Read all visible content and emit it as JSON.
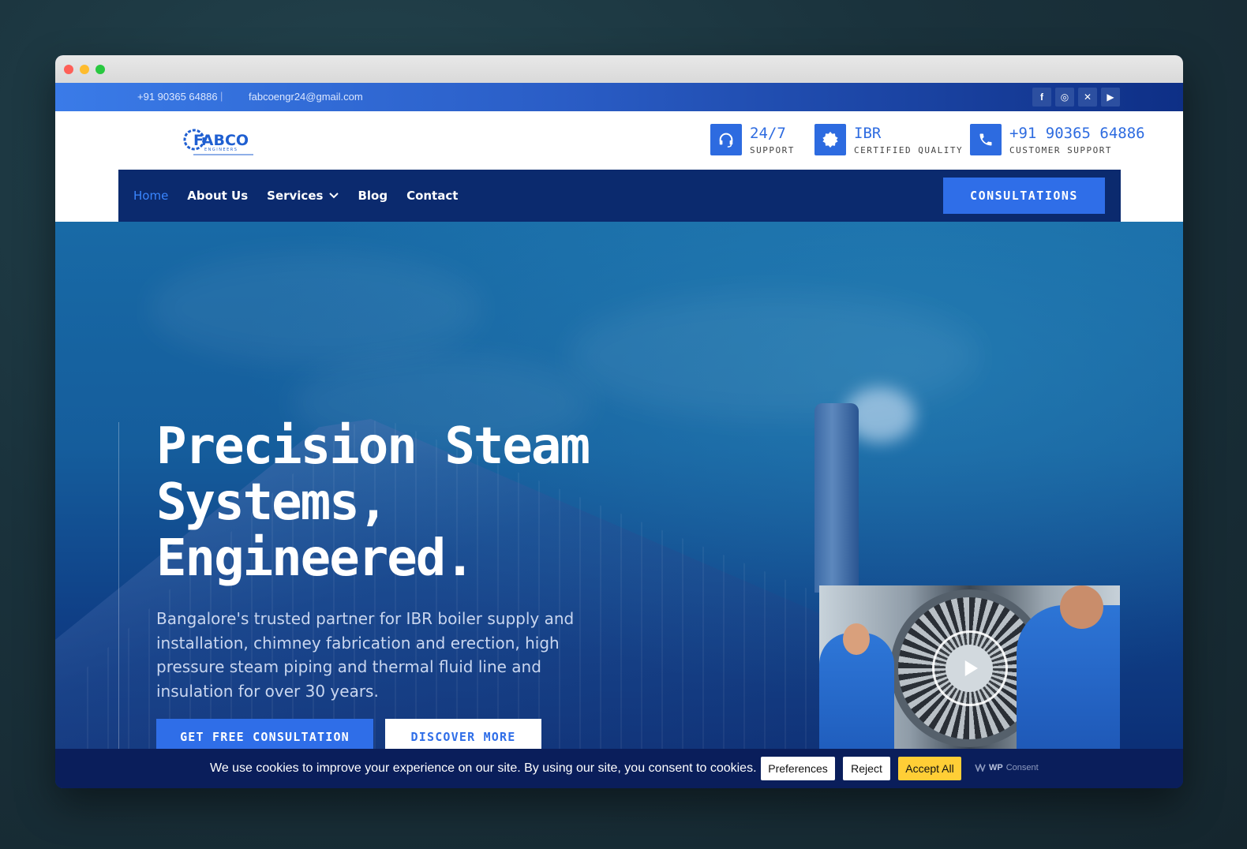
{
  "topbar": {
    "phone": "+91 90365 64886",
    "separator": "|",
    "email": "fabcoengr24@gmail.com",
    "socials": [
      {
        "icon": "facebook-icon",
        "glyph": "f"
      },
      {
        "icon": "instagram-icon",
        "glyph": "◎"
      },
      {
        "icon": "x-twitter-icon",
        "glyph": "✕"
      },
      {
        "icon": "youtube-icon",
        "glyph": "▶"
      }
    ]
  },
  "header": {
    "logo_text": "FABCO",
    "logo_sub": "ENGINEERS",
    "features": [
      {
        "icon": "headset-icon",
        "title": "24/7",
        "subtitle": "SUPPORT"
      },
      {
        "icon": "certified-badge-icon",
        "title": "IBR",
        "subtitle": "CERTIFIED QUALITY"
      },
      {
        "icon": "phone-icon",
        "title": "+91 90365 64886",
        "subtitle": "CUSTOMER SUPPORT"
      }
    ]
  },
  "nav": {
    "items": [
      {
        "label": "Home",
        "active": true
      },
      {
        "label": "About Us"
      },
      {
        "label": "Services",
        "dropdown": true
      },
      {
        "label": "Blog"
      },
      {
        "label": "Contact"
      }
    ],
    "cta": "CONSULTATIONS"
  },
  "hero": {
    "title_lines": [
      "Precision Steam",
      "Systems,",
      "Engineered."
    ],
    "subtitle": "Bangalore's trusted partner for IBR boiler supply and installation, chimney fabrication and erection, high pressure steam piping and thermal fluid line and insulation for over 30 years.",
    "primary_button": "GET FREE CONSULTATION",
    "secondary_button": "DISCOVER MORE"
  },
  "cookie": {
    "message": "We use cookies to improve your experience on our site. By using our site, you consent to cookies.",
    "preferences": "Preferences",
    "reject": "Reject",
    "accept": "Accept All",
    "brand_bold": "WP",
    "brand_rest": "Consent"
  },
  "colors": {
    "accent": "#2f6ee8",
    "navy": "#0b2a6e",
    "accept": "#ffce36"
  }
}
